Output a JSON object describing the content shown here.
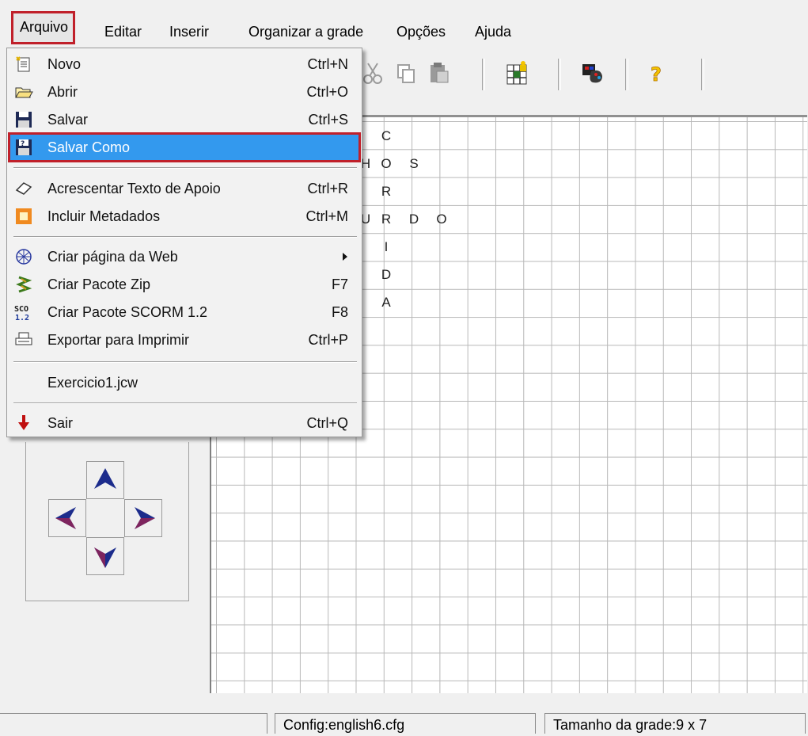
{
  "menubar": {
    "items": [
      "Arquivo",
      "Editar",
      "Inserir",
      "Organizar a grade",
      "Opções",
      "Ajuda"
    ]
  },
  "file_menu": {
    "items": [
      {
        "label": "Novo",
        "shortcut": "Ctrl+N",
        "icon": "new-document-icon"
      },
      {
        "label": "Abrir",
        "shortcut": "Ctrl+O",
        "icon": "open-folder-icon"
      },
      {
        "label": "Salvar",
        "shortcut": "Ctrl+S",
        "icon": "save-disk-icon"
      },
      {
        "label": "Salvar Como",
        "shortcut": "",
        "icon": "save-as-icon",
        "selected": true
      },
      {
        "label": "Acrescentar Texto de Apoio",
        "shortcut": "Ctrl+R",
        "icon": "eraser-icon"
      },
      {
        "label": "Incluir Metadados",
        "shortcut": "Ctrl+M",
        "icon": "metadata-icon"
      },
      {
        "label": "Criar página da Web",
        "shortcut": "",
        "icon": "web-icon",
        "submenu": true
      },
      {
        "label": "Criar Pacote Zip",
        "shortcut": "F7",
        "icon": "zip-icon"
      },
      {
        "label": "Criar Pacote SCORM 1.2",
        "shortcut": "F8",
        "icon": "scorm-icon"
      },
      {
        "label": "Exportar para Imprimir",
        "shortcut": "Ctrl+P",
        "icon": "printer-icon"
      },
      {
        "label": "Exercicio1.jcw",
        "shortcut": "",
        "icon": ""
      },
      {
        "label": "Sair",
        "shortcut": "Ctrl+Q",
        "icon": "exit-arrow-icon"
      }
    ],
    "scorm_icon_text": "SCO 1.2"
  },
  "grid_letters": [
    "C",
    "H",
    "O",
    "S",
    "R",
    "U",
    "R",
    "D",
    "O",
    "I",
    "D",
    "A"
  ],
  "status": {
    "config": "Config:english6.cfg",
    "grid_size": "Tamanho da grade:9 x 7"
  },
  "colors": {
    "highlight": "#3399ee",
    "callout_border": "#c0202a",
    "arrow_blue": "#1c2c8c",
    "help_yellow": "#f4c400"
  }
}
